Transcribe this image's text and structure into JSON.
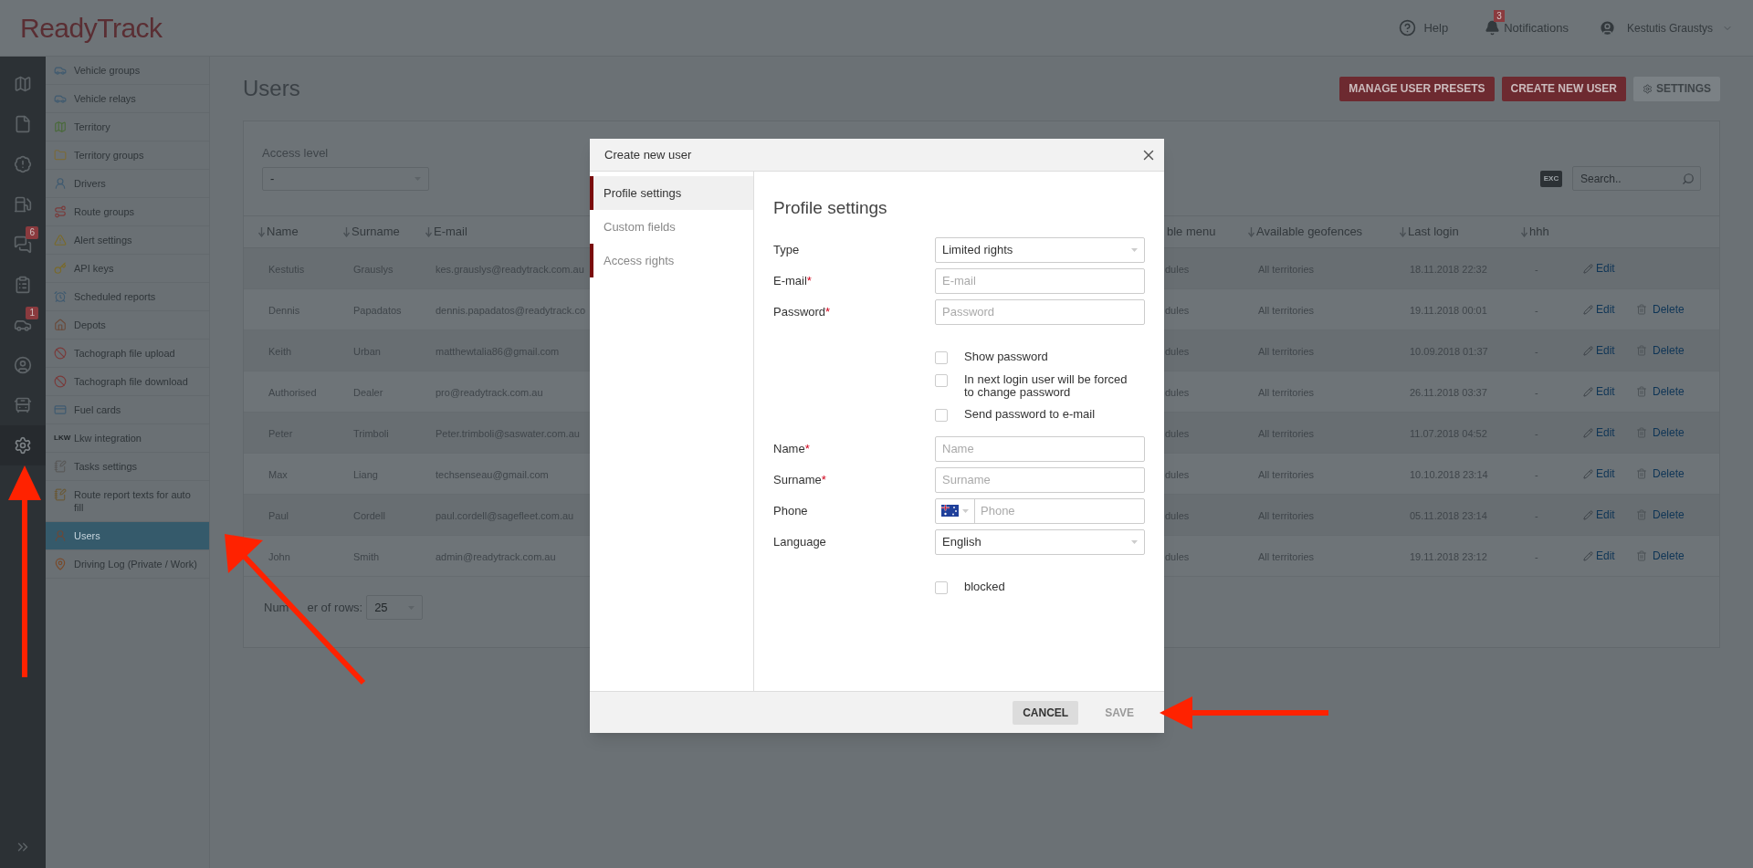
{
  "header": {
    "logo": "ReadyTrack",
    "help": "Help",
    "notifications": {
      "label": "Notifications",
      "badge": "3"
    },
    "user": "Kestutis Graustys"
  },
  "rail": [
    {
      "selected": false
    },
    {
      "selected": false
    },
    {
      "selected": false
    },
    {
      "selected": false
    },
    {
      "selected": false,
      "badge": "6"
    },
    {
      "selected": false
    },
    {
      "selected": false,
      "badge": "1"
    },
    {
      "selected": false
    },
    {
      "selected": false
    },
    {
      "selected": true
    }
  ],
  "sidebar": {
    "items": [
      {
        "label": "Vehicle groups",
        "selected": false
      },
      {
        "label": "Vehicle relays",
        "selected": false
      },
      {
        "label": "Territory",
        "selected": false
      },
      {
        "label": "Territory groups",
        "selected": false
      },
      {
        "label": "Drivers",
        "selected": false
      },
      {
        "label": "Route groups",
        "selected": false
      },
      {
        "label": "Alert settings",
        "selected": false
      },
      {
        "label": "API keys",
        "selected": false
      },
      {
        "label": "Scheduled reports",
        "selected": false
      },
      {
        "label": "Depots",
        "selected": false
      },
      {
        "label": "Tachograph file upload",
        "selected": false
      },
      {
        "label": "Tachograph file download",
        "selected": false
      },
      {
        "label": "Fuel cards",
        "selected": false
      },
      {
        "label": "Lkw integration",
        "selected": false,
        "icon_text": "LKW"
      },
      {
        "label": "Tasks settings",
        "selected": false
      },
      {
        "label": "Route report texts for auto fill",
        "selected": false
      },
      {
        "label": "Users",
        "selected": true
      },
      {
        "label": "Driving Log (Private / Work)",
        "selected": false
      }
    ]
  },
  "page": {
    "title": "Users",
    "buttons": [
      {
        "label": "MANAGE USER PRESETS",
        "kind": "primary"
      },
      {
        "label": "CREATE NEW USER",
        "kind": "primary"
      },
      {
        "label": "SETTINGS",
        "kind": "secondary"
      }
    ]
  },
  "filter": {
    "label": "Access level",
    "value": "-"
  },
  "export": {
    "label": "EXC"
  },
  "search": {
    "placeholder": "Search.."
  },
  "table": {
    "columns": [
      {
        "label": "Name",
        "sortable": true
      },
      {
        "label": "Surname",
        "sortable": true
      },
      {
        "label": "E-mail",
        "sortable": true
      },
      {
        "label": "ble menu",
        "sortable": false
      },
      {
        "label": "Available geofences",
        "sortable": true
      },
      {
        "label": "Last login",
        "sortable": true
      },
      {
        "label": "hhh",
        "sortable": true
      }
    ],
    "rows": [
      {
        "cells": [
          "Kestutis",
          "Grauslys",
          "kes.grauslys@readytrack.com.au",
          "dules",
          "All territories",
          "18.11.2018 22:32",
          "-"
        ],
        "edit": "Edit"
      },
      {
        "cells": [
          "Dennis",
          "Papadatos",
          "dennis.papadatos@readytrack.co",
          "dules",
          "All territories",
          "19.11.2018 00:01",
          "-"
        ],
        "edit": "Edit",
        "delete": "Delete"
      },
      {
        "cells": [
          "Keith",
          "Urban",
          "matthewtalia86@gmail.com",
          "dules",
          "All territories",
          "10.09.2018 01:37",
          "-"
        ],
        "edit": "Edit",
        "delete": "Delete"
      },
      {
        "cells": [
          "Authorised",
          "Dealer",
          "pro@readytrack.com.au",
          "dules",
          "All territories",
          "26.11.2018 03:37",
          "-"
        ],
        "edit": "Edit",
        "delete": "Delete"
      },
      {
        "cells": [
          "Peter",
          "Trimboli",
          "Peter.trimboli@saswater.com.au",
          "dules",
          "All territories",
          "11.07.2018 04:52",
          "-"
        ],
        "edit": "Edit",
        "delete": "Delete"
      },
      {
        "cells": [
          "Max",
          "Liang",
          "techsenseau@gmail.com",
          "dules",
          "All territories",
          "10.10.2018 23:14",
          "-"
        ],
        "edit": "Edit",
        "delete": "Delete"
      },
      {
        "cells": [
          "Paul",
          "Cordell",
          "paul.cordell@sagefleet.com.au",
          "dules",
          "All territories",
          "05.11.2018 23:14",
          "-"
        ],
        "edit": "Edit",
        "delete": "Delete"
      },
      {
        "cells": [
          "John",
          "Smith",
          "admin@readytrack.com.au",
          "dules",
          "All territories",
          "19.11.2018 23:12",
          "-"
        ],
        "edit": "Edit",
        "delete": "Delete"
      }
    ]
  },
  "pagination": {
    "label_parts": [
      "Num",
      "er of rows:"
    ],
    "value": "25"
  },
  "dialog": {
    "title": "Create new user",
    "tabs": [
      {
        "label": "Profile settings",
        "selected": true,
        "marked": true
      },
      {
        "label": "Custom fields",
        "selected": false,
        "marked": false
      },
      {
        "label": "Access rights",
        "selected": false,
        "marked": true
      }
    ],
    "heading": "Profile settings",
    "fields": [
      {
        "kind": "select",
        "label": "Type",
        "value": "Limited rights"
      },
      {
        "kind": "input",
        "label": "E-mail",
        "required_mark": "*",
        "placeholder": "E-mail"
      },
      {
        "kind": "input",
        "label": "Password",
        "required_mark": "*",
        "placeholder": "Password"
      },
      {
        "kind": "checkbox",
        "label": "Show password",
        "checked": false
      },
      {
        "kind": "checkbox",
        "label": "In next login user will be forced to change password",
        "checked": false
      },
      {
        "kind": "checkbox",
        "label": "Send password to e-mail",
        "checked": false
      },
      {
        "kind": "input",
        "label": "Name",
        "required_mark": "*",
        "placeholder": "Name"
      },
      {
        "kind": "input",
        "label": "Surname",
        "required_mark": "*",
        "placeholder": "Surname"
      },
      {
        "kind": "phone",
        "label": "Phone",
        "placeholder": "Phone"
      },
      {
        "kind": "select",
        "label": "Language",
        "value": "English"
      },
      {
        "kind": "checkbox",
        "label": "blocked",
        "checked": false
      }
    ],
    "buttons": [
      {
        "label": "CANCEL",
        "disabled": false
      },
      {
        "label": "SAVE",
        "disabled": true
      }
    ]
  },
  "annotations": [
    {
      "kind": "arrow"
    },
    {
      "kind": "arrow"
    },
    {
      "kind": "arrow"
    }
  ]
}
